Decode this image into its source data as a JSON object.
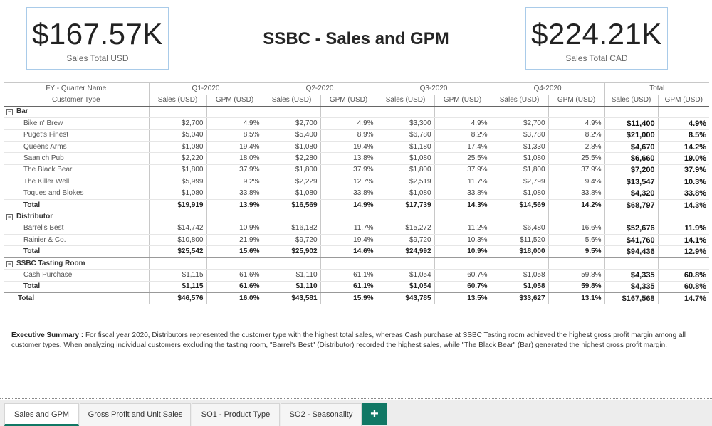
{
  "cards": {
    "left": {
      "value": "$167.57K",
      "label": "Sales Total USD"
    },
    "right": {
      "value": "$224.21K",
      "label": "Sales Total CAD"
    }
  },
  "title": "SSBC - Sales and GPM",
  "matrix": {
    "header_fy": "FY - Quarter Name",
    "header_customer": "Customer Type",
    "quarters": [
      "Q1-2020",
      "Q2-2020",
      "Q3-2020",
      "Q4-2020",
      "Total"
    ],
    "sales_col": "Sales (USD)",
    "gpm_col": "GPM (USD)",
    "expand_glyph": "−",
    "groups": [
      {
        "name": "Bar",
        "rows": [
          {
            "name": "Bike n' Brew",
            "vals": [
              "$2,700",
              "4.9%",
              "$2,700",
              "4.9%",
              "$3,300",
              "4.9%",
              "$2,700",
              "4.9%",
              "$11,400",
              "4.9%"
            ]
          },
          {
            "name": "Puget's Finest",
            "vals": [
              "$5,040",
              "8.5%",
              "$5,400",
              "8.9%",
              "$6,780",
              "8.2%",
              "$3,780",
              "8.2%",
              "$21,000",
              "8.5%"
            ]
          },
          {
            "name": "Queens Arms",
            "vals": [
              "$1,080",
              "19.4%",
              "$1,080",
              "19.4%",
              "$1,180",
              "17.4%",
              "$1,330",
              "2.8%",
              "$4,670",
              "14.2%"
            ]
          },
          {
            "name": "Saanich Pub",
            "vals": [
              "$2,220",
              "18.0%",
              "$2,280",
              "13.8%",
              "$1,080",
              "25.5%",
              "$1,080",
              "25.5%",
              "$6,660",
              "19.0%"
            ]
          },
          {
            "name": "The Black Bear",
            "vals": [
              "$1,800",
              "37.9%",
              "$1,800",
              "37.9%",
              "$1,800",
              "37.9%",
              "$1,800",
              "37.9%",
              "$7,200",
              "37.9%"
            ]
          },
          {
            "name": "The Killer Well",
            "vals": [
              "$5,999",
              "9.2%",
              "$2,229",
              "12.7%",
              "$2,519",
              "11.7%",
              "$2,799",
              "9.4%",
              "$13,547",
              "10.3%"
            ]
          },
          {
            "name": "Toques and Blokes",
            "vals": [
              "$1,080",
              "33.8%",
              "$1,080",
              "33.8%",
              "$1,080",
              "33.8%",
              "$1,080",
              "33.8%",
              "$4,320",
              "33.8%"
            ]
          }
        ],
        "total": {
          "name": "Total",
          "vals": [
            "$19,919",
            "13.9%",
            "$16,569",
            "14.9%",
            "$17,739",
            "14.3%",
            "$14,569",
            "14.2%",
            "$68,797",
            "14.3%"
          ]
        }
      },
      {
        "name": "Distributor",
        "rows": [
          {
            "name": "Barrel's Best",
            "vals": [
              "$14,742",
              "10.9%",
              "$16,182",
              "11.7%",
              "$15,272",
              "11.2%",
              "$6,480",
              "16.6%",
              "$52,676",
              "11.9%"
            ]
          },
          {
            "name": "Rainier & Co.",
            "vals": [
              "$10,800",
              "21.9%",
              "$9,720",
              "19.4%",
              "$9,720",
              "10.3%",
              "$11,520",
              "5.6%",
              "$41,760",
              "14.1%"
            ]
          }
        ],
        "total": {
          "name": "Total",
          "vals": [
            "$25,542",
            "15.6%",
            "$25,902",
            "14.6%",
            "$24,992",
            "10.9%",
            "$18,000",
            "9.5%",
            "$94,436",
            "12.9%"
          ]
        }
      },
      {
        "name": "SSBC Tasting Room",
        "rows": [
          {
            "name": "Cash Purchase",
            "vals": [
              "$1,115",
              "61.6%",
              "$1,110",
              "61.1%",
              "$1,054",
              "60.7%",
              "$1,058",
              "59.8%",
              "$4,335",
              "60.8%"
            ]
          }
        ],
        "total": {
          "name": "Total",
          "vals": [
            "$1,115",
            "61.6%",
            "$1,110",
            "61.1%",
            "$1,054",
            "60.7%",
            "$1,058",
            "59.8%",
            "$4,335",
            "60.8%"
          ]
        }
      }
    ],
    "grand_total": {
      "name": "Total",
      "vals": [
        "$46,576",
        "16.0%",
        "$43,581",
        "15.9%",
        "$43,785",
        "13.5%",
        "$33,627",
        "13.1%",
        "$167,568",
        "14.7%"
      ]
    }
  },
  "summary": {
    "label": "Executive Summary :",
    "text": " For fiscal year 2020, Distributors represented the customer type with the highest total sales, whereas Cash purchase at SSBC Tasting room achieved the highest gross profit margin among all customer types.  When analyzing individual customers excluding the tasting room,  \"Barrel's Best\" (Distributor) recorded the highest sales, while \"The Black Bear\" (Bar) generated the highest gross profit margin."
  },
  "tabs": [
    {
      "label": "Sales and GPM",
      "active": true
    },
    {
      "label": "Gross Profit and Unit Sales",
      "active": false
    },
    {
      "label": "SO1 - Product Type",
      "active": false
    },
    {
      "label": "SO2 - Seasonality",
      "active": false
    }
  ],
  "add_tab_label": "+",
  "colors": {
    "accent": "#117865",
    "card_border": "#a9cbe9"
  }
}
